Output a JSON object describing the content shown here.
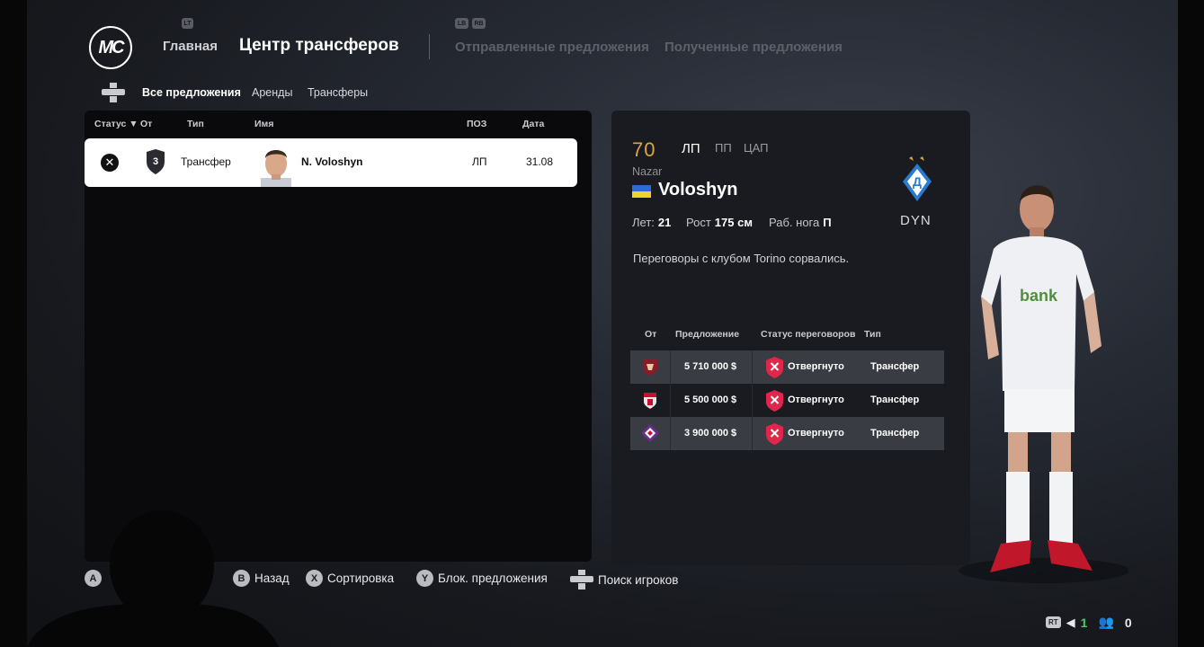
{
  "header": {
    "logo_text": "MC",
    "home_label": "Главная",
    "title": "Центр трансферов",
    "tabs": [
      "Отправленные предложения",
      "Полученные предложения"
    ],
    "hint_lb": "LB",
    "hint_rb": "RB",
    "hint_lt": "LT"
  },
  "subtabs": [
    "Все предложения",
    "Аренды",
    "Трансферы"
  ],
  "list": {
    "columns": {
      "status": "Статус",
      "from": "От",
      "type": "Тип",
      "name": "Имя",
      "pos": "ПОЗ",
      "date": "Дата"
    },
    "rows": [
      {
        "status_icon": "close-icon",
        "from_badge": "3",
        "type": "Трансфер",
        "name": "N. Voloshyn",
        "pos": "ЛП",
        "date": "31.08"
      }
    ]
  },
  "player": {
    "ovr": "70",
    "pos_main": "ЛП",
    "pos_alt": [
      "ПП",
      "ЦАП"
    ],
    "first_name": "Nazar",
    "last_name": "Voloshyn",
    "age_label": "Лет:",
    "age": "21",
    "height_label": "Рост",
    "height": "175 см",
    "foot_label": "Раб. нога",
    "foot": "П",
    "club_abbr": "DYN",
    "news": "Переговоры с клубом Torino сорвались.",
    "ovr_color": "#d9a642"
  },
  "offers": {
    "columns": {
      "from": "От",
      "offer": "Предложение",
      "status": "Статус переговоров",
      "type": "Тип"
    },
    "rows": [
      {
        "club_icon": "torino-crest-icon",
        "amount": "5 710 000 $",
        "status": "Отвергнуто",
        "type": "Трансфер"
      },
      {
        "club_icon": "augsburg-crest-icon",
        "amount": "5 500 000 $",
        "status": "Отвергнуто",
        "type": "Трансфер"
      },
      {
        "club_icon": "fiorentina-crest-icon",
        "amount": "3 900 000 $",
        "status": "Отвергнуто",
        "type": "Трансфер"
      }
    ],
    "rejected_color": "#e0264a"
  },
  "hints": [
    {
      "key": "A",
      "label": ""
    },
    {
      "key": "B",
      "label": "Назад"
    },
    {
      "key": "X",
      "label": "Сортировка"
    },
    {
      "key": "Y",
      "label": "Блок. предложения"
    },
    {
      "key": "R",
      "label": "Поиск игроков"
    }
  ],
  "system": {
    "rt": "RT",
    "count_1": "1",
    "count_2": "0"
  }
}
